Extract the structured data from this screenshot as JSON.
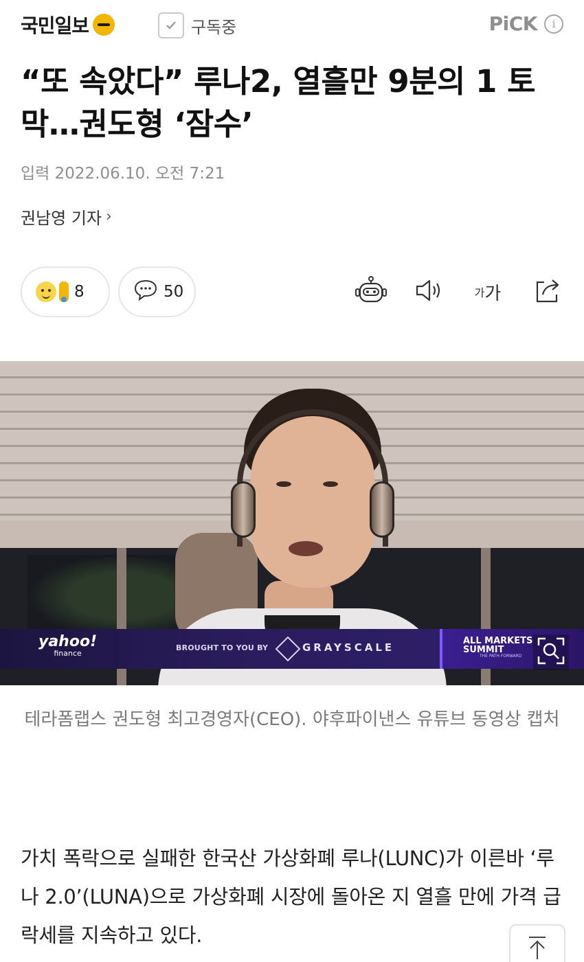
{
  "header": {
    "press_name": "국민일보",
    "subscribe_label": "구독중",
    "pick_label": "PiCK",
    "info_glyph": "i"
  },
  "article": {
    "headline": "“또 속았다” 루나2, 열흘만 9분의 1 토막…권도형 ‘잠수’",
    "dateline": "입력 2022.06.10. 오전 7:21",
    "reporter": "권남영 기자",
    "reporter_chevron": "›",
    "reaction_count": "8",
    "comment_count": "50",
    "font_label_small": "가",
    "font_label_large": "가"
  },
  "photo": {
    "banner_brand": "yahoo!",
    "banner_brand_sub": "finance",
    "banner_brought": "BROUGHT TO YOU BY",
    "banner_sponsor": "GRAYSCALE",
    "banner_event_line1": "ALL MARKETS",
    "banner_event_line2": "SUMMIT",
    "banner_event_tagline": "THE PATH FORWARD",
    "caption": "테라폼랩스 권도형 최고경영자(CEO). 야후파이낸스 유튜브 동영상 캡처"
  },
  "body": {
    "paragraph_1": "가치 폭락으로 실패한 한국산 가상화폐 루나(LUNC)가 이른바 ‘루나 2.0’(LUNA)으로 가상화폐 시장에 돌아온 지 열흘 만에 가격 급락세를 지속하고 있다."
  },
  "icons": {
    "press_logo": "press-logo-icon",
    "check": "check-icon",
    "info": "info-icon",
    "reaction": "emoji-reaction-icon",
    "comment": "comment-bubble-icon",
    "robot": "robot-summary-icon",
    "speaker": "speaker-icon",
    "share": "share-icon",
    "zoom": "zoom-search-icon",
    "to_top": "arrow-up-icon"
  },
  "colors": {
    "logo_accent": "#f2b705",
    "banner_bg": "#2a1c5c",
    "caption_text": "#7a7a7a"
  }
}
